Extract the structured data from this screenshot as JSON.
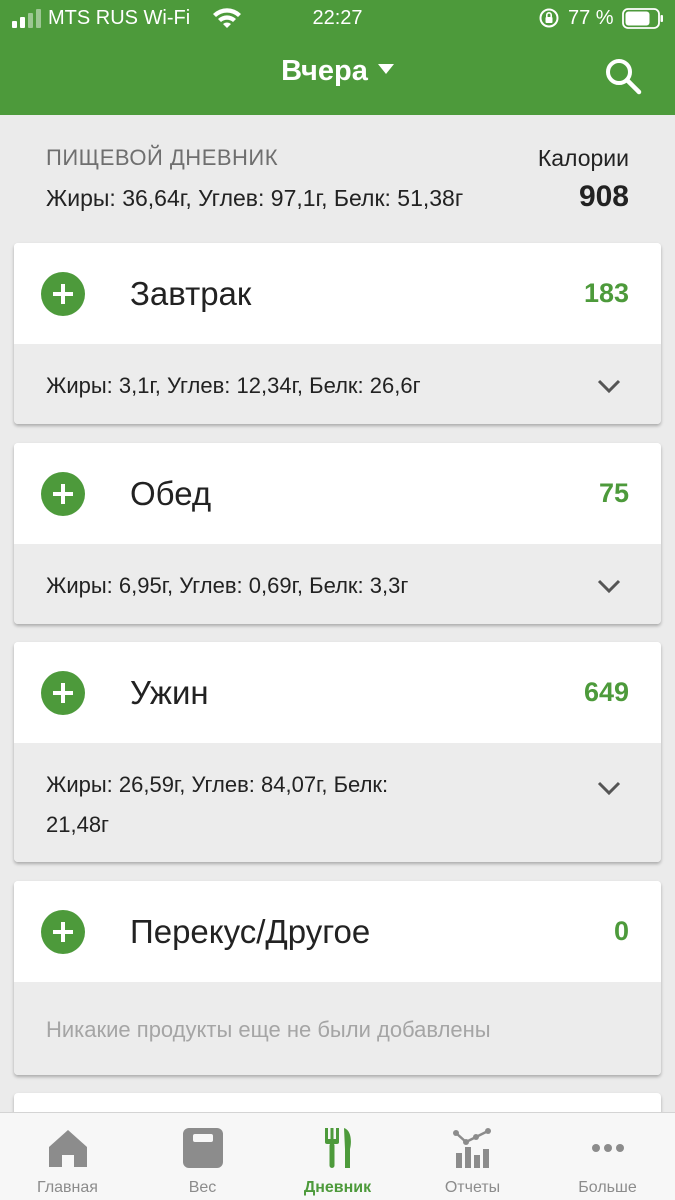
{
  "status_bar": {
    "carrier": "MTS RUS Wi-Fi",
    "time": "22:27",
    "battery": "77 %"
  },
  "header": {
    "title": "Вчера",
    "search_icon": "search-icon"
  },
  "summary": {
    "label": "ПИЩЕВОЙ ДНЕВНИК",
    "macros": "Жиры: 36,64г, Углев: 97,1г, Белк: 51,38г",
    "calories_label": "Калории",
    "calories_value": "908"
  },
  "meals": [
    {
      "name": "Завтрак",
      "kcal": "183",
      "detail": "Жиры: 3,1г, Углев: 12,34г, Белк: 26,6г"
    },
    {
      "name": "Обед",
      "kcal": "75",
      "detail": "Жиры: 6,95г, Углев: 0,69г, Белк: 3,3г"
    },
    {
      "name": "Ужин",
      "kcal": "649",
      "detail": "Жиры: 26,59г, Углев: 84,07г, Белк: 21,48г"
    },
    {
      "name": "Перекус/Другое",
      "kcal": "0",
      "detail": "Никакие продукты еще не были добавлены"
    }
  ],
  "tabs": [
    {
      "label": "Главная",
      "icon": "home-icon"
    },
    {
      "label": "Вес",
      "icon": "scale-icon"
    },
    {
      "label": "Дневник",
      "icon": "fork-knife-icon"
    },
    {
      "label": "Отчеты",
      "icon": "reports-chart-icon"
    },
    {
      "label": "Больше",
      "icon": "more-dots-icon"
    }
  ],
  "colors": {
    "brand_green": "#4d9a3b",
    "background": "#ebebeb",
    "tab_inactive": "#8c8c8c"
  }
}
